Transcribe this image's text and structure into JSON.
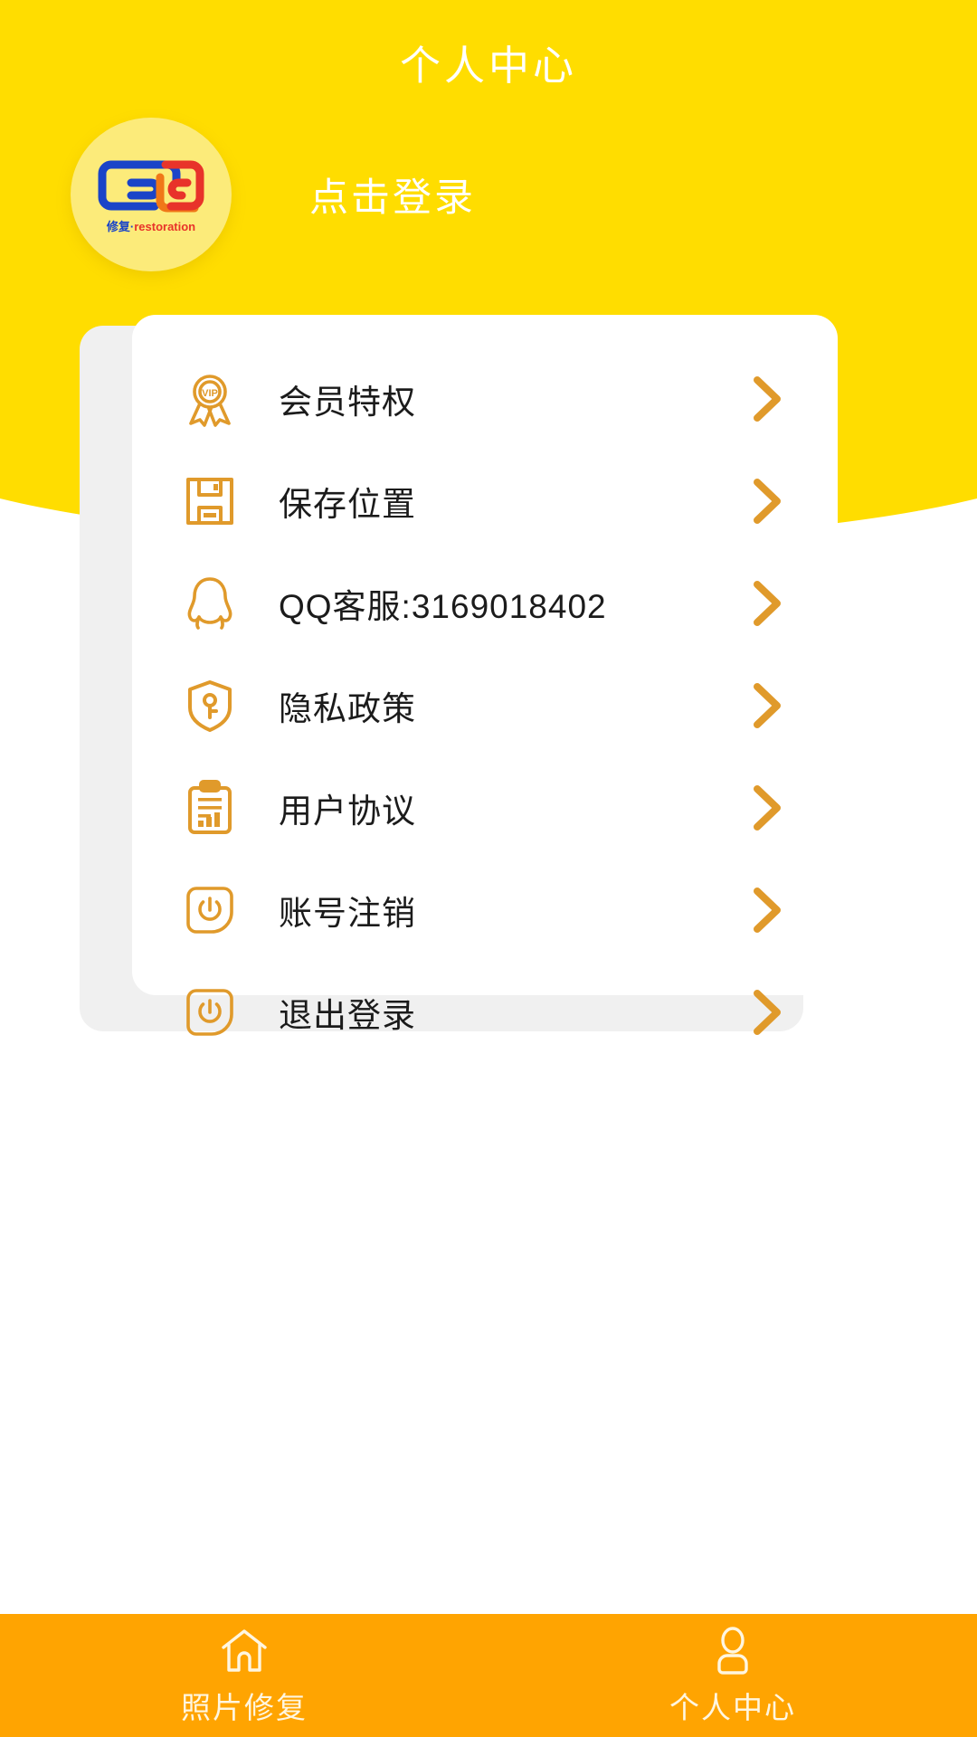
{
  "header": {
    "title": "个人中心",
    "login_label": "点击登录",
    "bg_color": "#FFDD00",
    "avatar": {
      "icon": "app-logo-icon",
      "sub_cn": "修复",
      "sub_sep": "·",
      "sub_en": "restoration",
      "circle_color": "#FCEB7A"
    }
  },
  "menu": {
    "accent_color": "#E09A2B",
    "items": [
      {
        "icon": "vip-badge-icon",
        "label": "会员特权",
        "arrow": "chevron-right-icon"
      },
      {
        "icon": "floppy-disk-icon",
        "label": "保存位置",
        "arrow": "chevron-right-icon"
      },
      {
        "icon": "qq-penguin-icon",
        "label": "QQ客服:3169018402",
        "arrow": "chevron-right-icon"
      },
      {
        "icon": "shield-key-icon",
        "label": "隐私政策",
        "arrow": "chevron-right-icon"
      },
      {
        "icon": "clipboard-icon",
        "label": "用户协议",
        "arrow": "chevron-right-icon"
      },
      {
        "icon": "power-icon",
        "label": "账号注销",
        "arrow": "chevron-right-icon"
      },
      {
        "icon": "power-icon",
        "label": "退出登录",
        "arrow": "chevron-right-icon"
      }
    ]
  },
  "tabbar": {
    "bg_color": "#FFA401",
    "items": [
      {
        "icon": "home-icon",
        "label": "照片修复",
        "active": false
      },
      {
        "icon": "person-icon",
        "label": "个人中心",
        "active": true
      }
    ]
  }
}
